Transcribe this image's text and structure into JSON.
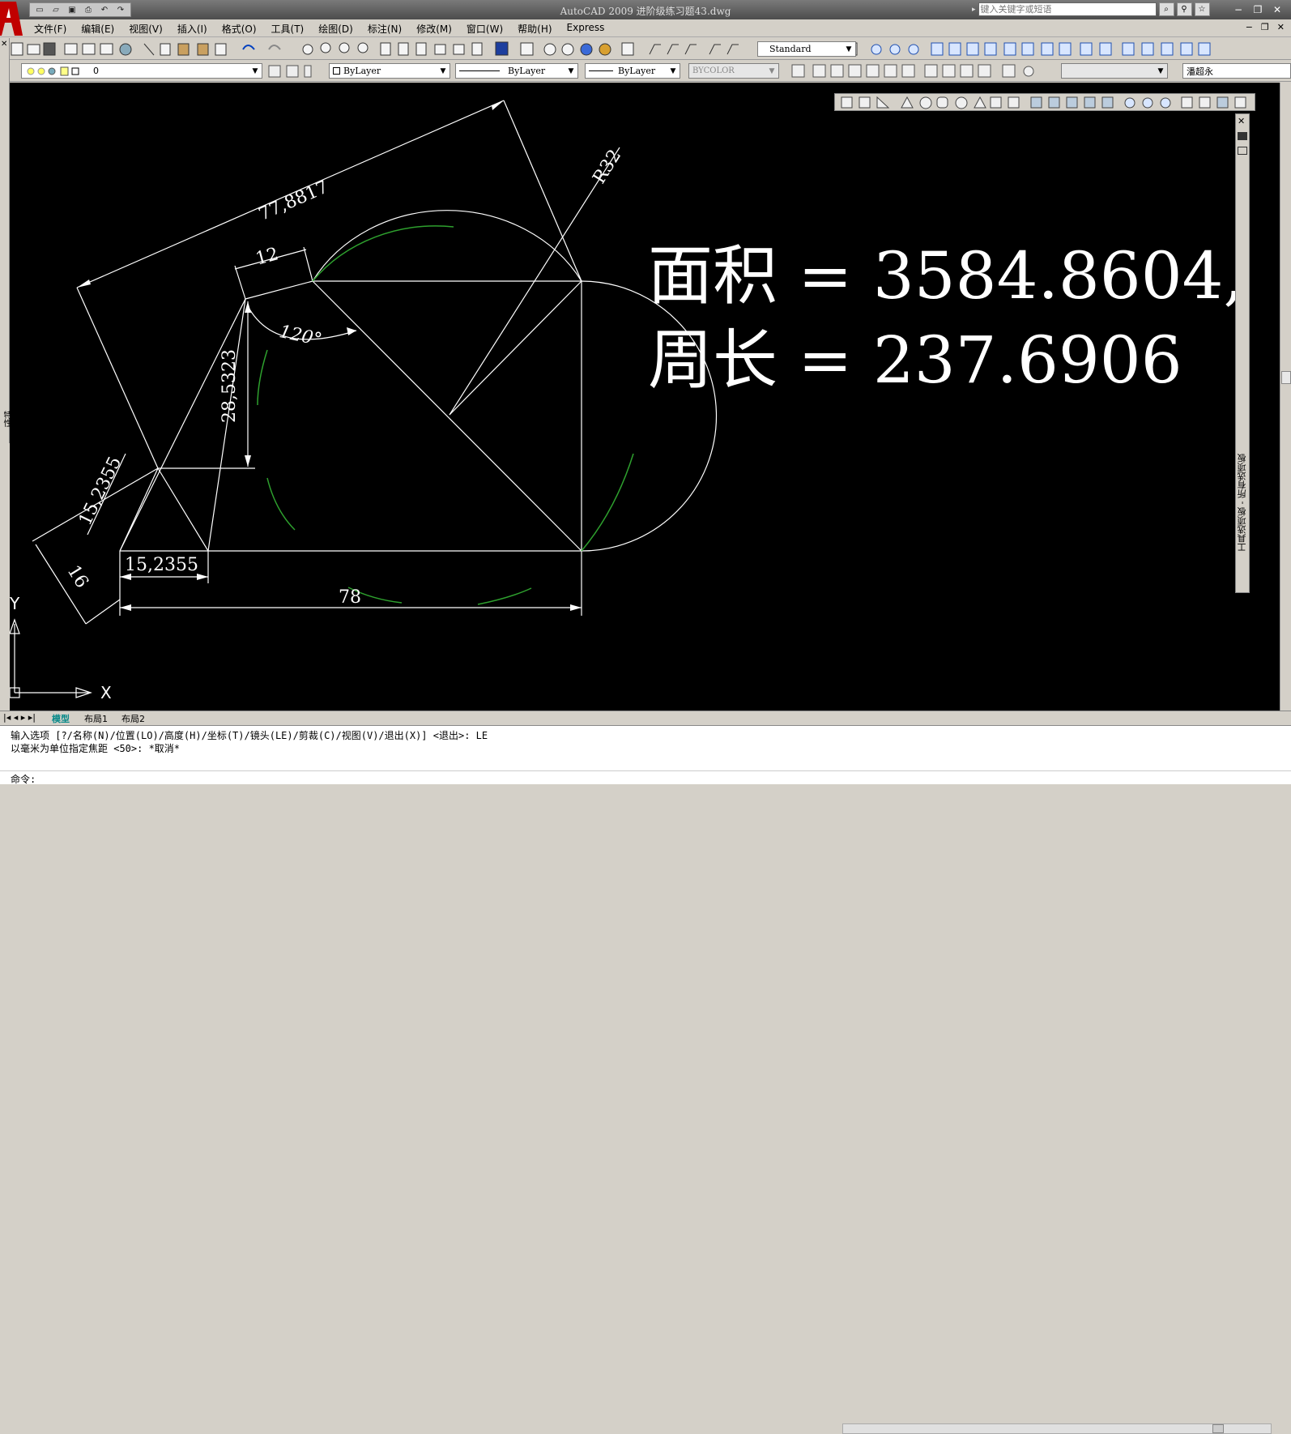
{
  "window": {
    "title": "AutoCAD 2009  进阶级练习题43.dwg",
    "search_placeholder": "键入关键字或短语",
    "min_label": "−",
    "restore_label": "❐",
    "close_label": "✕"
  },
  "menu": [
    "文件(F)",
    "编辑(E)",
    "视图(V)",
    "插入(I)",
    "格式(O)",
    "工具(T)",
    "绘图(D)",
    "标注(N)",
    "修改(M)",
    "窗口(W)",
    "帮助(H)",
    "Express"
  ],
  "toolbar": {
    "text_style": "Standard",
    "layer": "0",
    "color": "ByLayer",
    "linetype": "ByLayer",
    "lineweight": "ByLayer",
    "plotstyle": "BYCOLOR",
    "user_field": "潘超永"
  },
  "drawing": {
    "dim_total_length": "77,8817",
    "dim_radius": "R32",
    "dim_top_width": "12",
    "dim_angle": "120°",
    "dim_height": "28,5323",
    "dim_slant": "15,2355",
    "dim_bottom_left": "15,2355",
    "dim_left_edge": "16",
    "dim_base": "78",
    "area_text": "面积 = 3584.8604,",
    "perimeter_text": "周长 = 237.6906",
    "ucs_x": "X",
    "ucs_y": "Y"
  },
  "palette_title": "工具选项板 - 所有选项板",
  "left_panel_label": "特性",
  "tabs": [
    "模型",
    "布局1",
    "布局2"
  ],
  "command": {
    "line1": "输入选项 [?/名称(N)/位置(LO)/高度(H)/坐标(T)/镜头(LE)/剪裁(C)/视图(V)/退出(X)] <退出>: LE",
    "line2": "以毫米为单位指定焦距 <50>: *取消*",
    "prompt": "命令:"
  }
}
